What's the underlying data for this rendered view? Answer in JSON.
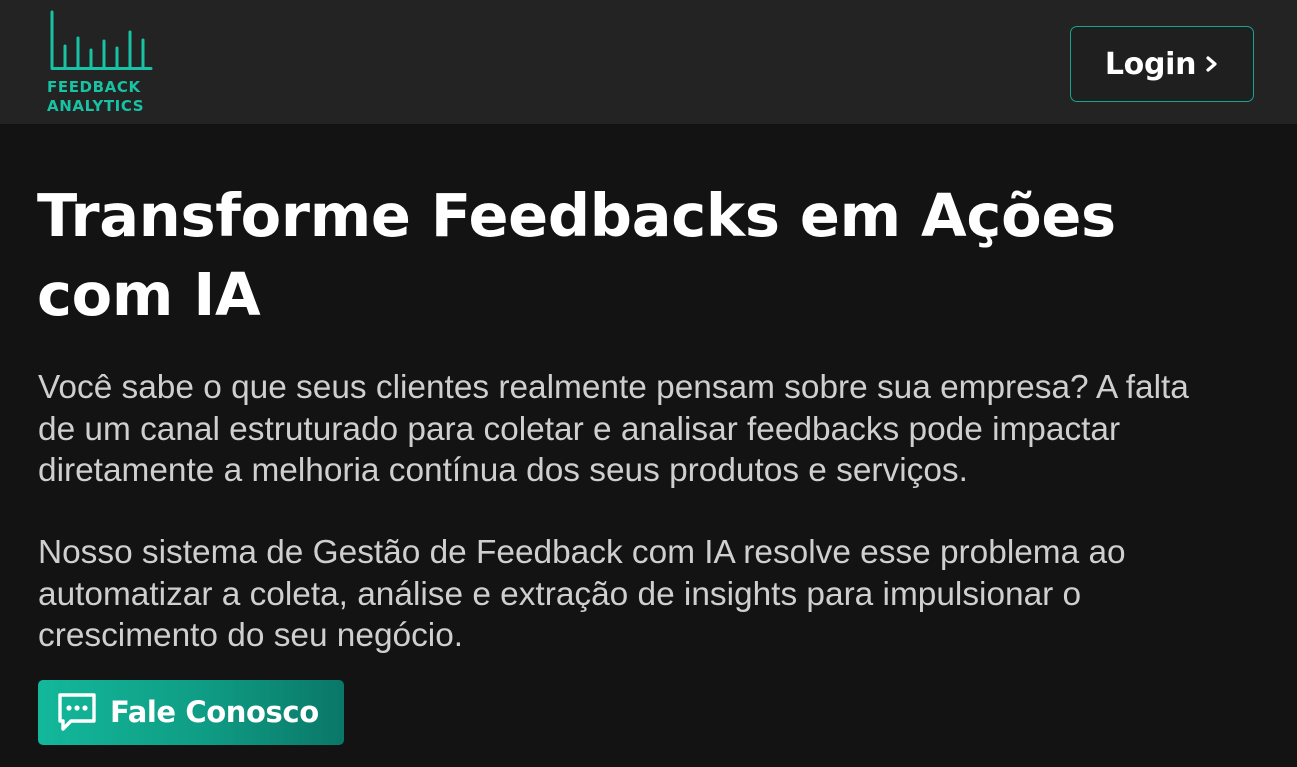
{
  "header": {
    "logo": {
      "icon": "bar-chart-logo",
      "text_line1": "FEEDBACK",
      "text_line2": "ANALYTICS",
      "color": "#18c3a5"
    },
    "login": {
      "label": "Login",
      "icon": "chevron-right-icon"
    }
  },
  "hero": {
    "title_line1": "Transforme Feedbacks em Ações",
    "title_line2": "com IA",
    "paragraph1": [
      "Você sabe o que seus clientes realmente pensam sobre sua empresa? A falta",
      "de um canal estruturado para coletar e analisar feedbacks pode impactar",
      "diretamente a melhoria contínua dos seus produtos e serviços."
    ],
    "paragraph2": [
      "Nosso sistema de Gestão de Feedback com IA resolve esse problema ao",
      "automatizar a coleta, análise e extração de insights para impulsionar o",
      "crescimento do seu negócio."
    ],
    "cta": {
      "label": "Fale Conosco",
      "icon": "chat-bubble-icon"
    }
  },
  "colors": {
    "accent": "#18c3a5",
    "header_bg": "#232323",
    "page_bg": "#131314",
    "body_text": "#cfcfcf"
  }
}
